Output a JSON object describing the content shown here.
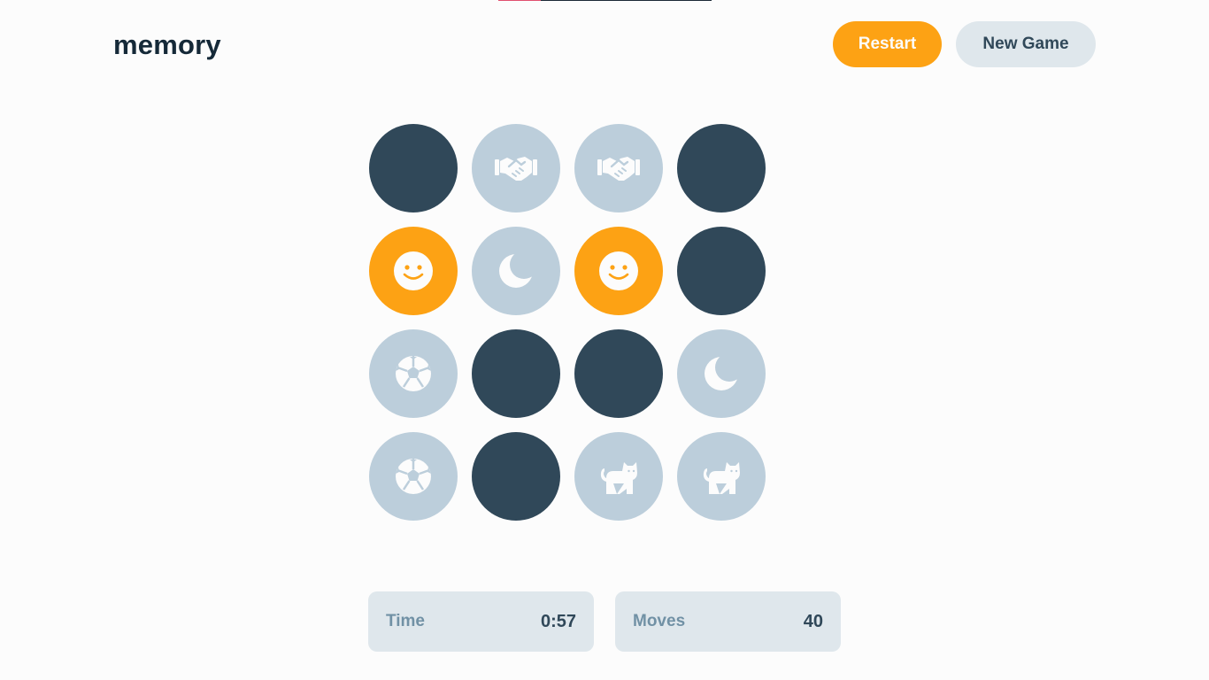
{
  "app": {
    "title": "memory"
  },
  "header": {
    "restart_label": "Restart",
    "new_game_label": "New Game"
  },
  "top_progress": {
    "fraction": 0.2
  },
  "colors": {
    "hidden": "#304859",
    "matched": "#bccedb",
    "selected": "#fda214",
    "accent": "#fda214",
    "text_dark": "#152938"
  },
  "board": {
    "rows": 4,
    "cols": 4,
    "tiles": [
      {
        "state": "hidden",
        "icon": ""
      },
      {
        "state": "matched",
        "icon": "handshake-icon"
      },
      {
        "state": "matched",
        "icon": "handshake-icon"
      },
      {
        "state": "hidden",
        "icon": ""
      },
      {
        "state": "selected",
        "icon": "smiley-icon"
      },
      {
        "state": "matched",
        "icon": "moon-icon"
      },
      {
        "state": "selected",
        "icon": "smiley-icon"
      },
      {
        "state": "hidden",
        "icon": ""
      },
      {
        "state": "matched",
        "icon": "soccer-ball-icon"
      },
      {
        "state": "hidden",
        "icon": ""
      },
      {
        "state": "hidden",
        "icon": ""
      },
      {
        "state": "matched",
        "icon": "moon-icon"
      },
      {
        "state": "matched",
        "icon": "soccer-ball-icon"
      },
      {
        "state": "hidden",
        "icon": ""
      },
      {
        "state": "matched",
        "icon": "cat-icon"
      },
      {
        "state": "matched",
        "icon": "cat-icon"
      }
    ]
  },
  "stats": {
    "time_label": "Time",
    "time_value": "0:57",
    "moves_label": "Moves",
    "moves_value": "40"
  }
}
